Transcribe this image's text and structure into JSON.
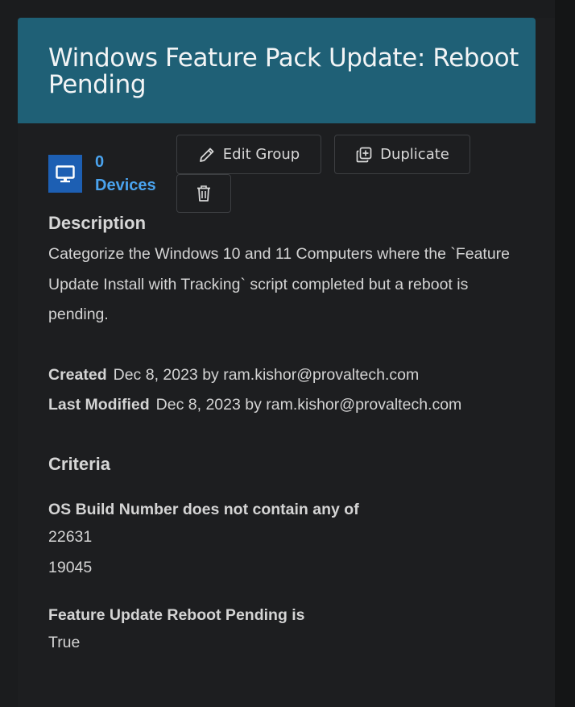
{
  "group": {
    "title": "Windows Feature Pack Update: Reboot Pending",
    "device_count": "0",
    "device_label": "Devices"
  },
  "actions": {
    "edit_label": "Edit Group",
    "duplicate_label": "Duplicate"
  },
  "description": {
    "heading": "Description",
    "text": "Categorize the Windows 10 and 11 Computers where the `Feature Update Install with Tracking` script completed but a reboot is pending."
  },
  "meta": {
    "created_label": "Created",
    "created_value": "Dec 8, 2023 by ram.kishor@provaltech.com",
    "modified_label": "Last Modified",
    "modified_value": "Dec 8, 2023 by ram.kishor@provaltech.com"
  },
  "criteria": {
    "heading": "Criteria",
    "items": [
      {
        "title": "OS Build Number does not contain any of",
        "values": [
          "22631",
          "19045"
        ]
      },
      {
        "title": "Feature Update Reboot Pending is",
        "values": [
          "True"
        ]
      }
    ]
  },
  "icons": {
    "devices": "monitor-icon",
    "edit": "pencil-icon",
    "duplicate": "duplicate-icon",
    "delete": "trash-icon"
  },
  "colors": {
    "header_bg": "#1f6076",
    "device_link": "#4aa3ee",
    "device_icon_bg": "#1d5fb3",
    "page_bg": "#1d1e20"
  }
}
